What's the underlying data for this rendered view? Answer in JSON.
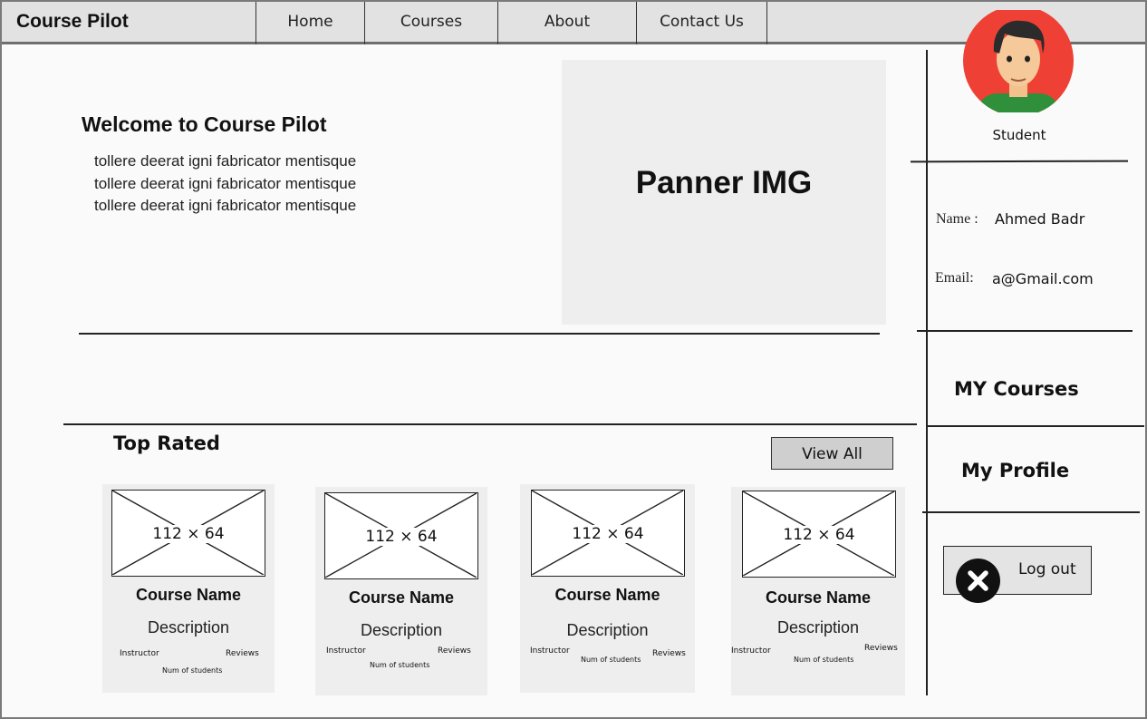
{
  "header": {
    "brand": "Course Pilot",
    "nav": [
      {
        "label": "Home"
      },
      {
        "label": "Courses"
      },
      {
        "label": "About"
      },
      {
        "label": "Contact Us"
      }
    ]
  },
  "hero": {
    "title": "Welcome to Course Pilot",
    "lines": [
      "tollere deerat igni fabricator mentisque",
      "tollere deerat igni fabricator mentisque",
      "tollere deerat igni fabricator mentisque"
    ],
    "banner_label": "Panner IMG"
  },
  "top_rated": {
    "title": "Top Rated",
    "view_all_label": "View All",
    "cards": [
      {
        "thumb": "112 × 64",
        "name": "Course Name",
        "description": "Description",
        "instructor": "Instructor",
        "reviews": "Reviews",
        "students": "Num of students"
      },
      {
        "thumb": "112 × 64",
        "name": "Course Name",
        "description": "Description",
        "instructor": "Instructor",
        "reviews": "Reviews",
        "students": "Num of students"
      },
      {
        "thumb": "112 × 64",
        "name": "Course Name",
        "description": "Description",
        "instructor": "Instructor",
        "reviews": "Reviews",
        "students": "Num of students"
      },
      {
        "thumb": "112 × 64",
        "name": "Course Name",
        "description": "Description",
        "instructor": "Instructor",
        "reviews": "Reviews",
        "students": "Num of students"
      }
    ]
  },
  "sidebar": {
    "role": "Student",
    "name_label": "Name :",
    "name_value": "Ahmed Badr",
    "email_label": "Email:",
    "email_value": "a@Gmail.com",
    "my_courses": "MY Courses",
    "my_profile": "My Profile",
    "logout": "Log out",
    "avatar_icon": "user-avatar-icon",
    "logout_icon": "close-icon"
  },
  "colors": {
    "nav_bg": "#e2e2e2",
    "banner_bg": "#eeeeee",
    "avatar_bg": "#ee4035",
    "button_bg": "#cfcfcf"
  }
}
